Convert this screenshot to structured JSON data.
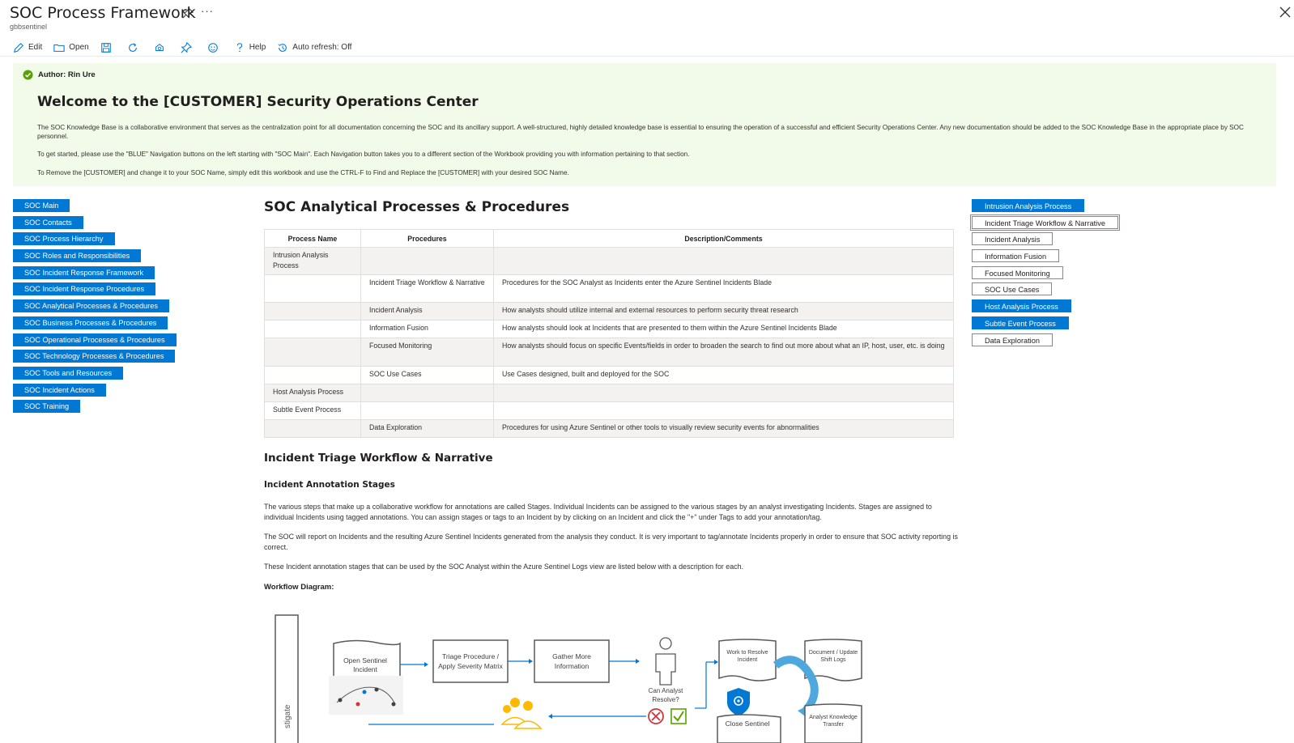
{
  "header": {
    "title": "SOC Process Framework",
    "subtitle": "gbbsentinel",
    "more": "···"
  },
  "toolbar": {
    "edit": "Edit",
    "open": "Open",
    "help": "Help",
    "auto_refresh": "Auto refresh: Off"
  },
  "banner": {
    "author": "Author: Rin Ure",
    "welcome": "Welcome to the [CUSTOMER] Security Operations Center",
    "p1": "The SOC Knowledge Base is a collaborative environment that serves as the centralization point for all documentation concerning the SOC and its ancillary support. A well-structured, highly detailed knowledge base is essential to ensuring the operation of a successful and efficient Security Operations Center. Any new documentation should be added to the SOC Knowledge Base in the appropriate place by SOC personnel.",
    "p2": "To get started, please use the \"BLUE\" Navigation buttons on the left starting with \"SOC Main\". Each Navigation button takes you to a different section of the Workbook providing you with information pertaining to that section.",
    "p3": "To Remove the [CUSTOMER] and change it to your SOC Name, simply edit this workbook and use the CTRL-F to Find and Replace the [CUSTOMER] with your desired SOC Name."
  },
  "leftnav": [
    "SOC Main",
    "SOC Contacts",
    "SOC Process Hierarchy",
    "SOC Roles and Responsibilities",
    "SOC Incident Response Framework",
    "SOC Incident Response Procedures",
    "SOC Analytical Processes & Procedures",
    "SOC Business Processes & Procedures",
    "SOC Operational Processes & Procedures",
    "SOC Technology Processes & Procedures",
    "SOC Tools and Resources",
    "SOC Incident Actions",
    "SOC Training"
  ],
  "main": {
    "title": "SOC Analytical Processes & Procedures",
    "table": {
      "headers": [
        "Process Name",
        "Procedures",
        "Description/Comments"
      ],
      "rows": [
        [
          "Intrusion Analysis Process",
          "",
          ""
        ],
        [
          "",
          "Incident Triage Workflow & Narrative",
          "Procedures for the SOC Analyst as Incidents enter the Azure Sentinel Incidents Blade"
        ],
        [
          "",
          "Incident Analysis",
          "How analysts should utilize internal and external resources to perform security threat research"
        ],
        [
          "",
          "Information Fusion",
          "How analysts should look at Incidents that are presented to them within the Azure Sentinel Incidents Blade"
        ],
        [
          "",
          "Focused Monitoring",
          "How analysts should focus on specific Events/fields in order to broaden the search to find out more about what an IP, host, user, etc. is doing"
        ],
        [
          "",
          "SOC Use Cases",
          "Use Cases designed, built and deployed for the SOC"
        ],
        [
          "Host Analysis Process",
          "",
          ""
        ],
        [
          "Subtle Event Process",
          "",
          ""
        ],
        [
          "",
          "Data Exploration",
          "Procedures for using Azure Sentinel or other tools to visually review security events for abnormalities"
        ]
      ]
    },
    "h2": "Incident Triage Workflow & Narrative",
    "h3": "Incident Annotation Stages",
    "para1": "The various steps that make up a collaborative workflow for annotations are called Stages. Individual Incidents can be assigned to the various stages by an analyst investigating Incidents. Stages are assigned to individual Incidents using tagged annotations. You can assign stages or tags to an Incident by by clicking on an Incident and click the \"+\" under Tags to add your annotation/tag.",
    "para2": "The SOC will report on Incidents and the resulting Azure Sentinel Incidents generated from the analysis they conduct. It is very important to tag/annotate Incidents properly in order to ensure that SOC activity reporting is correct.",
    "para3": "These Incident annotation stages that can be used by the SOC Analyst within the Azure Sentinel Logs view are listed below with a description for each.",
    "workflow_label": "Workflow Diagram:"
  },
  "rightnav": [
    {
      "label": "Intrusion Analysis Process",
      "style": "blue"
    },
    {
      "label": "Incident Triage Workflow & Narrative",
      "style": "white"
    },
    {
      "label": "Incident Analysis",
      "style": "white"
    },
    {
      "label": "Information Fusion",
      "style": "white"
    },
    {
      "label": "Focused Monitoring",
      "style": "white"
    },
    {
      "label": "SOC Use Cases",
      "style": "white"
    },
    {
      "label": "Host Analysis Process",
      "style": "blue"
    },
    {
      "label": "Subtle Event Process",
      "style": "blue"
    },
    {
      "label": "Data Exploration",
      "style": "white"
    }
  ],
  "diagram": {
    "open_incident": [
      "Open Sentinel",
      "Incident"
    ],
    "triage": [
      "Triage Procedure /",
      "Apply Severity Matrix"
    ],
    "gather": [
      "Gather More",
      "Information"
    ],
    "can_analyst": [
      "Can Analyst",
      "Resolve?"
    ],
    "work_resolve": [
      "Work to Resolve",
      "Incident"
    ],
    "document": [
      "Document / Update",
      "Shift Logs"
    ],
    "close": "Close Sentinel",
    "analyst_knowledge": [
      "Analyst Knowledge",
      "Transfer"
    ],
    "side_text": "stigate"
  },
  "colors": {
    "accent": "#0078d4",
    "banner_bg": "#f2fbe9",
    "success": "#57a300",
    "error": "#d13438"
  }
}
